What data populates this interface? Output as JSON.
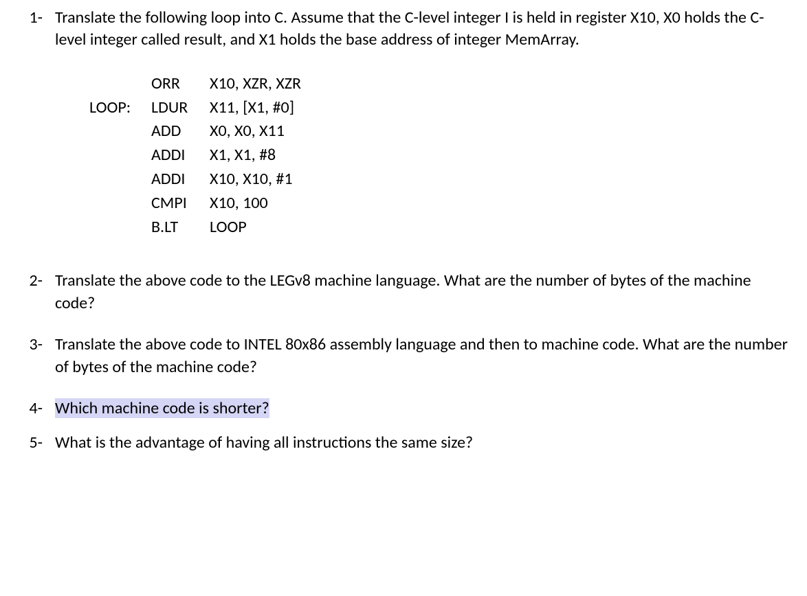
{
  "questions": {
    "q1": {
      "number": "1-",
      "text": "Translate the following loop into C. Assume that the C-level integer I is held in register X10, X0 holds the C-level integer called result, and X1 holds the base address of integer MemArray."
    },
    "q2": {
      "number": "2-",
      "text": "Translate the above code to the LEGv8 machine language. What are the number of bytes of the machine code?"
    },
    "q3": {
      "number": "3-",
      "text": "Translate the above code to INTEL 80x86 assembly language and then to machine code. What are the number of bytes of the machine code?"
    },
    "q4": {
      "number": "4-",
      "text": "Which machine code is shorter?"
    },
    "q5": {
      "number": "5-",
      "text": "What is the advantage of having all instructions the same size?"
    }
  },
  "code": {
    "line1": {
      "label": "",
      "mnemonic": "ORR",
      "operands": "X10, XZR, XZR"
    },
    "line2": {
      "label": "LOOP:",
      "mnemonic": "LDUR",
      "operands": "X11, [X1, #0]"
    },
    "line3": {
      "label": "",
      "mnemonic": "ADD",
      "operands": "X0, X0, X11"
    },
    "line4": {
      "label": "",
      "mnemonic": "ADDI",
      "operands": "X1, X1, #8"
    },
    "line5": {
      "label": "",
      "mnemonic": "ADDI",
      "operands": "X10, X10, #1"
    },
    "line6": {
      "label": "",
      "mnemonic": "CMPI",
      "operands": "X10, 100"
    },
    "line7": {
      "label": "",
      "mnemonic": "B.LT",
      "operands": "LOOP"
    }
  }
}
